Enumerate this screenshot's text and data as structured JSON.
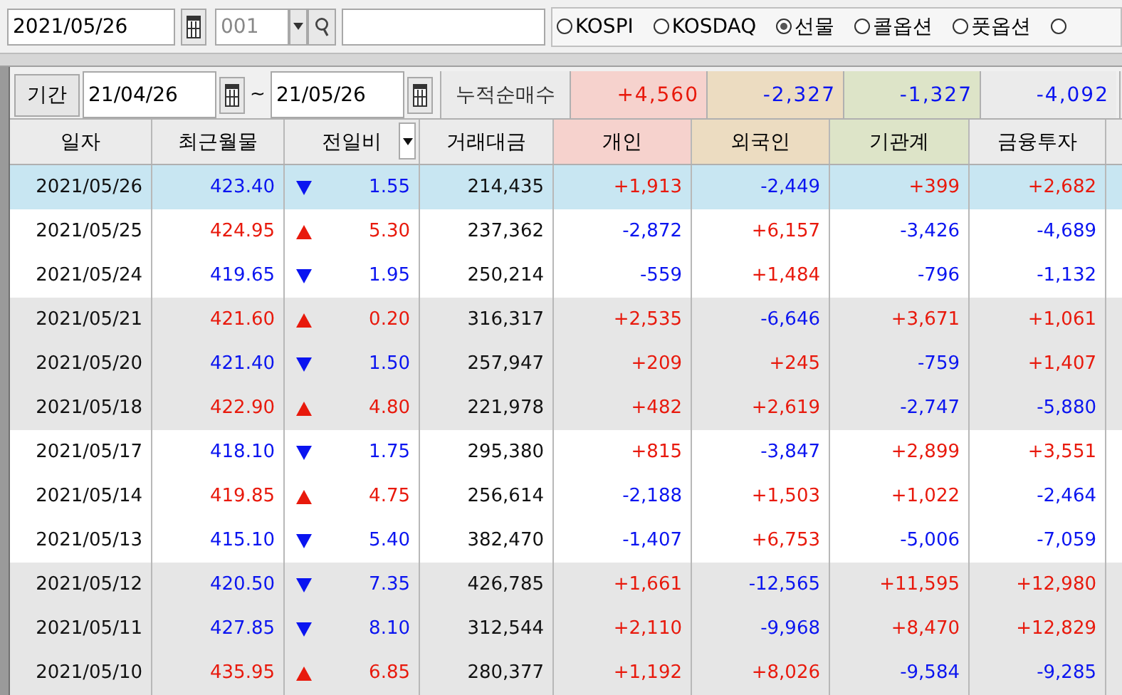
{
  "toolbar": {
    "date": "2021/05/26",
    "code": "001",
    "markets": [
      {
        "label": "KOSPI",
        "selected": false
      },
      {
        "label": "KOSDAQ",
        "selected": false
      },
      {
        "label": "선물",
        "selected": true
      },
      {
        "label": "콜옵션",
        "selected": false
      },
      {
        "label": "풋옵션",
        "selected": false
      },
      {
        "selected": false
      }
    ]
  },
  "period": {
    "button": "기간",
    "from": "21/04/26",
    "separator": "~",
    "to": "21/05/26",
    "summary_label": "누적순매수",
    "summary": [
      {
        "text": "+4,560",
        "up": true
      },
      {
        "text": "-2,327",
        "up": false
      },
      {
        "text": "-1,327",
        "up": false
      },
      {
        "text": "-4,092",
        "up": false
      }
    ]
  },
  "table": {
    "columns": [
      "일자",
      "최근월물",
      "전일비",
      "거래대금",
      "개인",
      "외국인",
      "기관계",
      "금융투자"
    ],
    "rows": [
      {
        "date": "2021/05/26",
        "price": "423.40",
        "up": false,
        "change": "1.55",
        "amount": "214,435",
        "net": [
          "+1,913",
          "-2,449",
          "+399",
          "+2,682"
        ],
        "net_up": [
          true,
          false,
          true,
          true
        ],
        "selected": true
      },
      {
        "date": "2021/05/25",
        "price": "424.95",
        "up": true,
        "change": "5.30",
        "amount": "237,362",
        "net": [
          "-2,872",
          "+6,157",
          "-3,426",
          "-4,689"
        ],
        "net_up": [
          false,
          true,
          false,
          false
        ],
        "selected": false,
        "shaded": false
      },
      {
        "date": "2021/05/24",
        "price": "419.65",
        "up": false,
        "change": "1.95",
        "amount": "250,214",
        "net": [
          "-559",
          "+1,484",
          "-796",
          "-1,132"
        ],
        "net_up": [
          false,
          true,
          false,
          false
        ],
        "selected": false,
        "shaded": false
      },
      {
        "date": "2021/05/21",
        "price": "421.60",
        "up": true,
        "change": "0.20",
        "amount": "316,317",
        "net": [
          "+2,535",
          "-6,646",
          "+3,671",
          "+1,061"
        ],
        "net_up": [
          true,
          false,
          true,
          true
        ],
        "selected": false,
        "shaded": true
      },
      {
        "date": "2021/05/20",
        "price": "421.40",
        "up": false,
        "change": "1.50",
        "amount": "257,947",
        "net": [
          "+209",
          "+245",
          "-759",
          "+1,407"
        ],
        "net_up": [
          true,
          true,
          false,
          true
        ],
        "selected": false,
        "shaded": true
      },
      {
        "date": "2021/05/18",
        "price": "422.90",
        "up": true,
        "change": "4.80",
        "amount": "221,978",
        "net": [
          "+482",
          "+2,619",
          "-2,747",
          "-5,880"
        ],
        "net_up": [
          true,
          true,
          false,
          false
        ],
        "selected": false,
        "shaded": true
      },
      {
        "date": "2021/05/17",
        "price": "418.10",
        "up": false,
        "change": "1.75",
        "amount": "295,380",
        "net": [
          "+815",
          "-3,847",
          "+2,899",
          "+3,551"
        ],
        "net_up": [
          true,
          false,
          true,
          true
        ],
        "selected": false,
        "shaded": false
      },
      {
        "date": "2021/05/14",
        "price": "419.85",
        "up": true,
        "change": "4.75",
        "amount": "256,614",
        "net": [
          "-2,188",
          "+1,503",
          "+1,022",
          "-2,464"
        ],
        "net_up": [
          false,
          true,
          true,
          false
        ],
        "selected": false,
        "shaded": false
      },
      {
        "date": "2021/05/13",
        "price": "415.10",
        "up": false,
        "change": "5.40",
        "amount": "382,470",
        "net": [
          "-1,407",
          "+6,753",
          "-5,006",
          "-7,059"
        ],
        "net_up": [
          false,
          true,
          false,
          false
        ],
        "selected": false,
        "shaded": false
      },
      {
        "date": "2021/05/12",
        "price": "420.50",
        "up": false,
        "change": "7.35",
        "amount": "426,785",
        "net": [
          "+1,661",
          "-12,565",
          "+11,595",
          "+12,980"
        ],
        "net_up": [
          true,
          false,
          true,
          true
        ],
        "selected": false,
        "shaded": true
      },
      {
        "date": "2021/05/11",
        "price": "427.85",
        "up": false,
        "change": "8.10",
        "amount": "312,544",
        "net": [
          "+2,110",
          "-9,968",
          "+8,470",
          "+12,829"
        ],
        "net_up": [
          true,
          false,
          true,
          true
        ],
        "selected": false,
        "shaded": true
      },
      {
        "date": "2021/05/10",
        "price": "435.95",
        "up": true,
        "change": "6.85",
        "amount": "280,377",
        "net": [
          "+1,192",
          "+8,026",
          "-9,584",
          "-9,285"
        ],
        "net_up": [
          true,
          true,
          false,
          false
        ],
        "selected": false,
        "shaded": true
      }
    ]
  }
}
